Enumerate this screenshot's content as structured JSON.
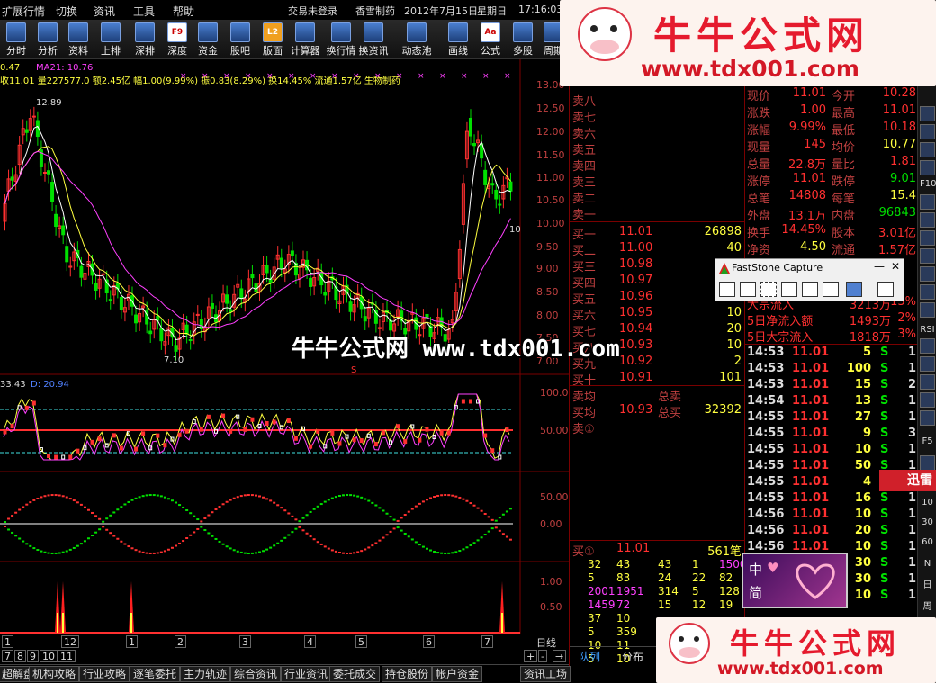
{
  "menu": {
    "items": [
      "扩展行情",
      "切换",
      "资讯",
      "工具",
      "帮助"
    ],
    "status": "交易未登录",
    "stock_name": "香雪制药",
    "date": "2012年7月15日",
    "weekday": "星期日",
    "time": "17:16:03"
  },
  "toolbar": [
    "分时",
    "分析",
    "资料",
    "上排",
    "深排",
    "深度",
    "资金",
    "股吧",
    "版面",
    "计算器",
    "换行情",
    "换资讯",
    "动态池",
    "画线",
    "公式",
    "多股",
    "周期"
  ],
  "toolbar_icons": [
    "F9",
    "L2",
    "Aa"
  ],
  "chart": {
    "ma_line": {
      "close_label": "0.47",
      "ma21": "MA21: 10.76",
      "quote": "收11.01 量227577.0 额2.45亿 幅1.00(9.99%) 振0.83(8.29%) 换14.45% 流通1.57亿 生物制药"
    },
    "y_labels": [
      "13.00",
      "12.50",
      "12.00",
      "11.50",
      "11.00",
      "10.50",
      "10.00",
      "9.50",
      "9.00",
      "8.50",
      "8.00",
      "7.50",
      "7.00"
    ],
    "high_label": "12.89",
    "low_label": "7.10",
    "current_label": "10",
    "marker": "S",
    "ind1": {
      "val": "33.43",
      "val2": "D: 20.94",
      "y": [
        "100.0",
        "50.00"
      ]
    },
    "ind2": {
      "y": [
        "50.00",
        "0.00"
      ]
    },
    "ind3": {
      "y": [
        "1.00",
        "0.50"
      ]
    }
  },
  "period": {
    "months_top": [
      "1",
      "12",
      "1",
      "2",
      "3",
      "4",
      "5",
      "6",
      "7"
    ],
    "months_bottom": [
      "7",
      "8",
      "9",
      "10",
      "11"
    ],
    "label": "日线",
    "nav": [
      "+",
      "-",
      "→"
    ]
  },
  "bottom_tabs": [
    "超解盘",
    "机构攻略",
    "行业攻略",
    "逐笔委托",
    "主力轨迹",
    "综合资讯",
    "行业资讯",
    "委托成交",
    "持仓股份",
    "帐户资金",
    "资讯工场"
  ],
  "orderbook": {
    "sells": [
      "卖八",
      "卖七",
      "卖六",
      "卖五",
      "卖四",
      "卖三",
      "卖二",
      "卖一"
    ],
    "buys": [
      {
        "label": "买一",
        "price": "11.01",
        "vol": "26898"
      },
      {
        "label": "买二",
        "price": "11.00",
        "vol": "40"
      },
      {
        "label": "买三",
        "price": "10.98",
        "vol": "10"
      },
      {
        "label": "买四",
        "price": "10.97",
        "vol": "10"
      },
      {
        "label": "买五",
        "price": "10.96",
        "vol": "10"
      },
      {
        "label": "买六",
        "price": "10.95",
        "vol": "10"
      },
      {
        "label": "买七",
        "price": "10.94",
        "vol": "20"
      },
      {
        "label": "买八",
        "price": "10.93",
        "vol": "10"
      },
      {
        "label": "买九",
        "price": "10.92",
        "vol": "2"
      },
      {
        "label": "买十",
        "price": "10.91",
        "vol": "101"
      }
    ],
    "avg_sell_label": "卖均",
    "total_sell_label": "总卖",
    "avg_buy_label": "买均",
    "avg_buy_price": "10.93",
    "total_buy_label": "总买",
    "total_buy": "32392",
    "sell1_label": "卖①",
    "queue_label": "买①",
    "queue_price": "11.01",
    "queue_count": "561笔",
    "queue": [
      [
        "32",
        "43",
        "43",
        "1",
        "1500"
      ],
      [
        "5",
        "83",
        "24",
        "22",
        "82"
      ],
      [
        "2001",
        "1951",
        "314",
        "5",
        "128"
      ],
      [
        "1459",
        "72",
        "15",
        "12",
        "19"
      ],
      [
        "37",
        "10",
        "",
        "",
        ""
      ],
      [
        "5",
        "359",
        "",
        "",
        ""
      ],
      [
        "10",
        "11",
        "",
        "",
        ""
      ],
      [
        "5",
        "10",
        "",
        "",
        ""
      ]
    ],
    "tabs": [
      "队列",
      "分布"
    ]
  },
  "info": {
    "rows": [
      {
        "l1": "现价",
        "v1": "11.01",
        "l2": "今开",
        "v2": "10.28"
      },
      {
        "l1": "涨跌",
        "v1": "1.00",
        "l2": "最高",
        "v2": "11.01"
      },
      {
        "l1": "涨幅",
        "v1": "9.99%",
        "l2": "最低",
        "v2": "10.18"
      },
      {
        "l1": "现量",
        "v1": "145",
        "l2": "均价",
        "v2": "10.77"
      },
      {
        "l1": "总量",
        "v1": "22.8万",
        "l2": "量比",
        "v2": "1.81"
      },
      {
        "l1": "涨停",
        "v1": "11.01",
        "l2": "跌停",
        "v2": "9.01"
      },
      {
        "l1": "总笔",
        "v1": "14808",
        "l2": "每笔",
        "v2": "15.4"
      },
      {
        "l1": "外盘",
        "v1": "13.1万",
        "l2": "内盘",
        "v2": "96843"
      },
      {
        "l1": "换手",
        "v1": "14.45%",
        "l2": "股本",
        "v2": "3.01亿"
      },
      {
        "l1": "净资",
        "v1": "4.50",
        "l2": "流通",
        "v2": "1.57亿"
      }
    ],
    "flows": [
      {
        "label": "大宗流入",
        "v": "3213万",
        "p": "13%"
      },
      {
        "label": "5日净流入额",
        "v": "1493万",
        "p": "2%"
      },
      {
        "label": "5日大宗流入",
        "v": "1818万",
        "p": "3%"
      }
    ],
    "ticks": [
      [
        "14:53",
        "11.01",
        "5",
        "S",
        "1"
      ],
      [
        "14:53",
        "11.01",
        "100",
        "S",
        "1"
      ],
      [
        "14:53",
        "11.01",
        "15",
        "S",
        "2"
      ],
      [
        "14:54",
        "11.01",
        "13",
        "S",
        "1"
      ],
      [
        "14:55",
        "11.01",
        "27",
        "S",
        "1"
      ],
      [
        "14:55",
        "11.01",
        "9",
        "S",
        "3"
      ],
      [
        "14:55",
        "11.01",
        "10",
        "S",
        "1"
      ],
      [
        "14:55",
        "11.01",
        "50",
        "S",
        "1"
      ],
      [
        "14:55",
        "11.01",
        "4",
        "S",
        ""
      ],
      [
        "14:55",
        "11.01",
        "16",
        "S",
        "1"
      ],
      [
        "14:56",
        "11.01",
        "10",
        "S",
        "1"
      ],
      [
        "14:56",
        "11.01",
        "20",
        "S",
        "1"
      ],
      [
        "14:56",
        "11.01",
        "10",
        "S",
        "1"
      ],
      [
        "",
        "",
        "30",
        "S",
        "1"
      ],
      [
        "",
        "",
        "30",
        "S",
        "1"
      ],
      [
        "14:56",
        "11.01",
        "10",
        "S",
        "1"
      ]
    ]
  },
  "side_strip": [
    "F10",
    "RSI",
    "F5",
    "10",
    "30",
    "60",
    "N",
    "日",
    "周"
  ],
  "fsc": {
    "title": "FastStone Capture",
    "min": "—",
    "max": "□",
    "close": "✕"
  },
  "watermark": "牛牛公式网 www.tdx001.com",
  "banner": {
    "title": "牛牛公式网",
    "url": "www.tdx001.com"
  },
  "lang": {
    "a": "中",
    "b": "简"
  },
  "xunlei": "迅雷",
  "colors": {
    "up": "#ff3030",
    "down": "#00e000",
    "yellow": "#ffff40",
    "cyan": "#40e0e0",
    "magenta": "#ff40ff",
    "label": "#c04040"
  }
}
